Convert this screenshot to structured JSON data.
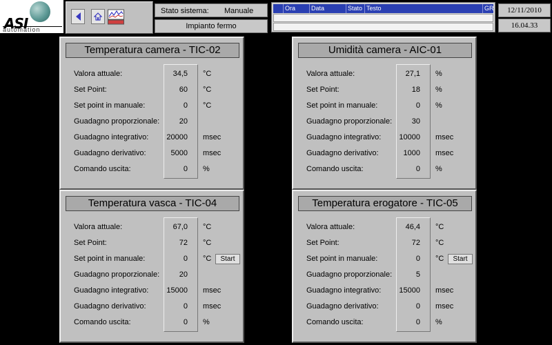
{
  "header": {
    "logo": {
      "brand": "ASI",
      "subtitle": "automation"
    },
    "status_label": "Stato sistema:",
    "status_value": "Manuale",
    "plant_status": "Impianto fermo",
    "alarm_columns": [
      "Ora",
      "Data",
      "Stato",
      "Testo",
      "GR"
    ],
    "date": "12/11/2010",
    "time": "16.04.33"
  },
  "panels": [
    {
      "title": "Temperatura camera - TIC-02",
      "rows": [
        {
          "label": "Valora attuale:",
          "value": "34,5",
          "unit": "°C"
        },
        {
          "label": "Set Point:",
          "value": "60",
          "unit": "°C"
        },
        {
          "label": "Set point in manuale:",
          "value": "0",
          "unit": "°C"
        },
        {
          "label": "Guadagno proporzionale:",
          "value": "20",
          "unit": ""
        },
        {
          "label": "Guadagno integrativo:",
          "value": "20000",
          "unit": "msec"
        },
        {
          "label": "Guadagno derivativo:",
          "value": "5000",
          "unit": "msec"
        },
        {
          "label": "Comando uscita:",
          "value": "0",
          "unit": "%"
        }
      ]
    },
    {
      "title": "Umidità camera - AIC-01",
      "rows": [
        {
          "label": "Valora attuale:",
          "value": "27,1",
          "unit": "%"
        },
        {
          "label": "Set Point:",
          "value": "18",
          "unit": "%"
        },
        {
          "label": "Set point in manuale:",
          "value": "0",
          "unit": "%"
        },
        {
          "label": "Guadagno proporzionale:",
          "value": "30",
          "unit": ""
        },
        {
          "label": "Guadagno integrativo:",
          "value": "10000",
          "unit": "msec"
        },
        {
          "label": "Guadagno derivativo:",
          "value": "1000",
          "unit": "msec"
        },
        {
          "label": "Comando uscita:",
          "value": "0",
          "unit": "%"
        }
      ]
    },
    {
      "title": "Temperatura vasca - TIC-04",
      "start_label": "Start",
      "rows": [
        {
          "label": "Valora attuale:",
          "value": "67,0",
          "unit": "°C"
        },
        {
          "label": "Set Point:",
          "value": "72",
          "unit": "°C"
        },
        {
          "label": "Set point in manuale:",
          "value": "0",
          "unit": "°C"
        },
        {
          "label": "Guadagno proporzionale:",
          "value": "20",
          "unit": ""
        },
        {
          "label": "Guadagno integrativo:",
          "value": "15000",
          "unit": "msec"
        },
        {
          "label": "Guadagno derivativo:",
          "value": "0",
          "unit": "msec"
        },
        {
          "label": "Comando uscita:",
          "value": "0",
          "unit": "%"
        }
      ]
    },
    {
      "title": "Temperatura erogatore - TIC-05",
      "start_label": "Start",
      "rows": [
        {
          "label": "Valora attuale:",
          "value": "46,4",
          "unit": "°C"
        },
        {
          "label": "Set Point:",
          "value": "72",
          "unit": "°C"
        },
        {
          "label": "Set point in manuale:",
          "value": "0",
          "unit": "°C"
        },
        {
          "label": "Guadagno proporzionale:",
          "value": "5",
          "unit": ""
        },
        {
          "label": "Guadagno integrativo:",
          "value": "15000",
          "unit": "msec"
        },
        {
          "label": "Guadagno derivativo:",
          "value": "0",
          "unit": "msec"
        },
        {
          "label": "Comando uscita:",
          "value": "0",
          "unit": "%"
        }
      ]
    }
  ],
  "icons": {
    "back": "arrow-left-icon",
    "home": "home-icon",
    "trend": "trend-icon"
  },
  "colors": {
    "panel_bg": "#c0c0c0",
    "title_bg": "#a9a9a9",
    "alarm_header": "#2a3fb2",
    "logo_globe": "#5e9a96"
  }
}
